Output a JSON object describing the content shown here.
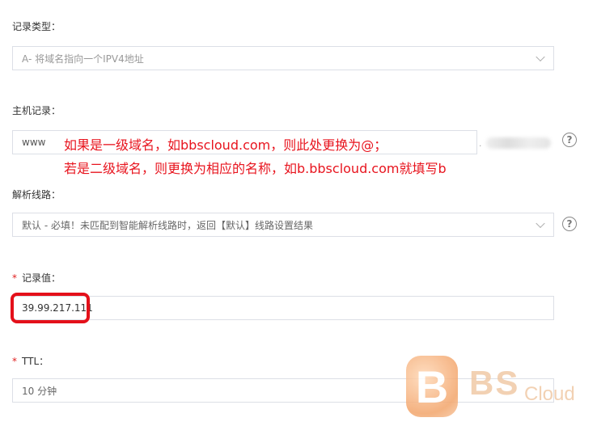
{
  "record_type": {
    "label": "记录类型：",
    "value": "A- 将域名指向一个IPV4地址"
  },
  "host": {
    "label": "主机记录：",
    "value": "www",
    "domain_suffix_dot": "."
  },
  "annotation": {
    "line1": "如果是一级域名，如bbscloud.com，则此处更换为@；",
    "line2": "若是二级域名，则更换为相应的名称，如b.bbscloud.com就填写b"
  },
  "line": {
    "label": "解析线路：",
    "value": "默认 - 必填！未匹配到智能解析线路时，返回【默认】线路设置结果"
  },
  "record_value": {
    "required_mark": "*",
    "label": "记录值：",
    "value": "39.99.217.111"
  },
  "ttl": {
    "required_mark": "*",
    "label": "TTL：",
    "value": "10 分钟"
  },
  "help_glyph": "?",
  "watermark": {
    "b": "B",
    "bs": "BS",
    "cloud": "Cloud"
  },
  "colors": {
    "annotation": "#e8141e",
    "required": "#e02020",
    "highlight_border": "#e4101a",
    "field_border": "#dcdfe6"
  }
}
